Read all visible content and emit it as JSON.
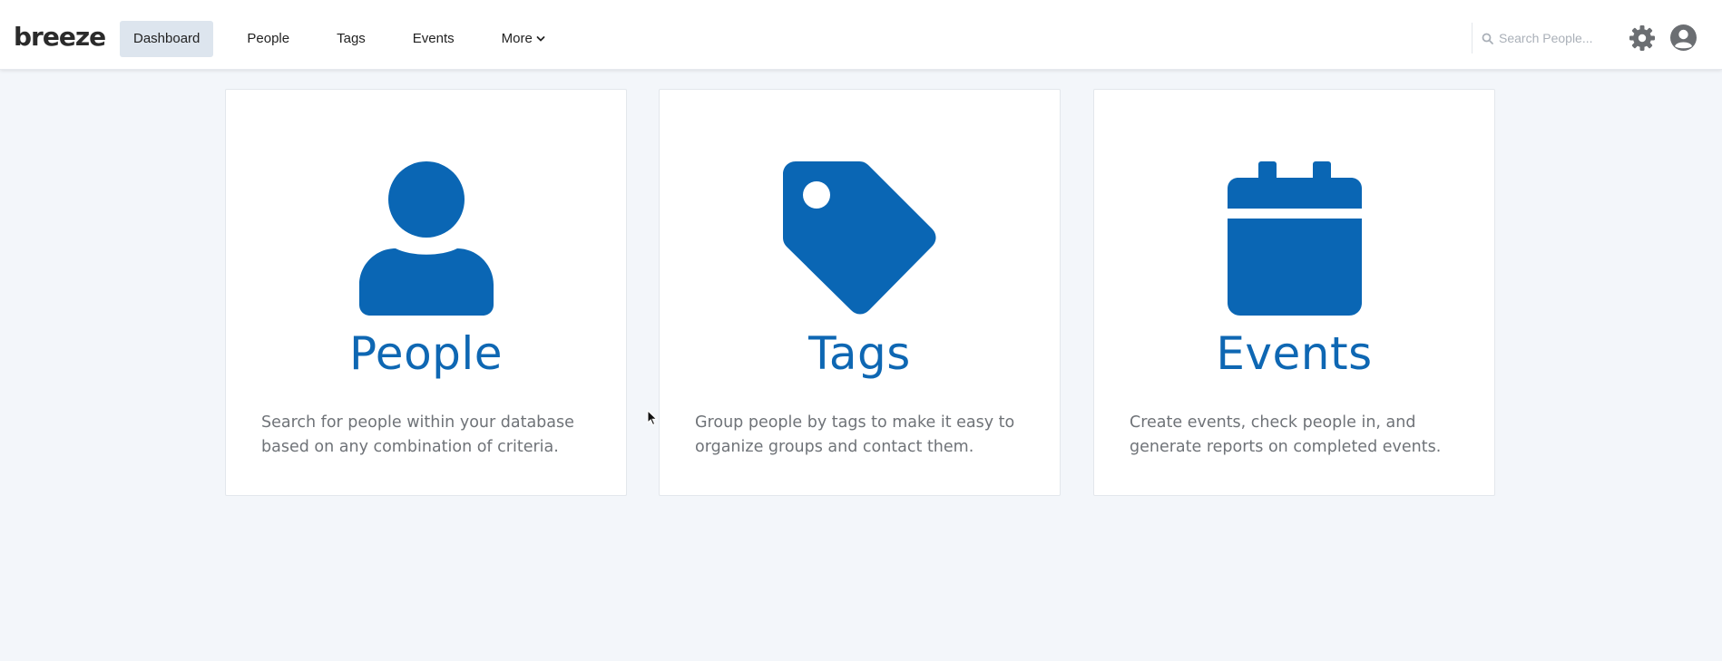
{
  "app": {
    "logo_text": "breeze"
  },
  "nav": {
    "dashboard": "Dashboard",
    "people": "People",
    "tags": "Tags",
    "events": "Events",
    "more": "More"
  },
  "search": {
    "placeholder": "Search People..."
  },
  "cards": [
    {
      "title": "People",
      "description": "Search for people within your database based on any combination of criteria.",
      "icon": "person-icon"
    },
    {
      "title": "Tags",
      "description": "Group people by tags to make it easy to organize groups and contact them.",
      "icon": "tag-icon"
    },
    {
      "title": "Events",
      "description": "Create events, check people in, and generate reports on completed events.",
      "icon": "calendar-icon"
    }
  ],
  "colors": {
    "accent": "#0e67b3",
    "icon_blue": "#0a66b4",
    "background": "#f3f6fa"
  },
  "icons": {
    "search": "search-icon",
    "settings": "gear-icon",
    "user": "user-circle-icon",
    "more": "chevron-down-icon"
  }
}
